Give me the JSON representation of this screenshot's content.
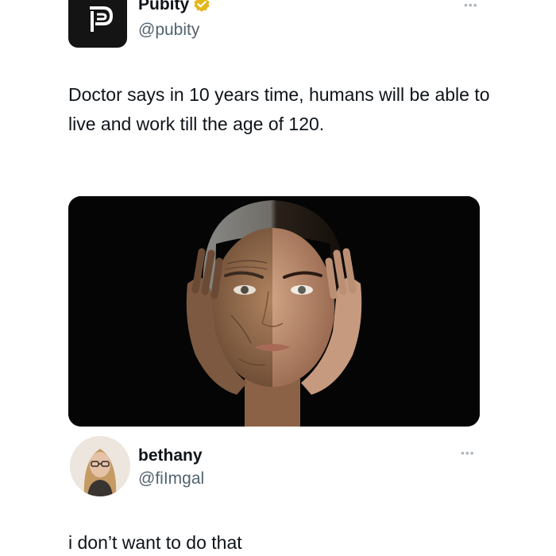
{
  "tweet": {
    "author_name": "Pubity",
    "author_handle": "@pubity",
    "text": "Doctor says in 10 years time, humans will be able to live and work till the age of 120.",
    "verified_badge_icon": "verified-badge-icon",
    "more_icon": "more-options-icon"
  },
  "reply": {
    "author_name": "bethany",
    "author_handle": "@fiImgal",
    "text": "i don’t want to do that",
    "more_icon": "more-options-icon"
  },
  "colors": {
    "text_primary": "#0f1419",
    "text_secondary": "#536471",
    "badge_gold": "#e2b719",
    "avatar_dark": "#141414"
  }
}
